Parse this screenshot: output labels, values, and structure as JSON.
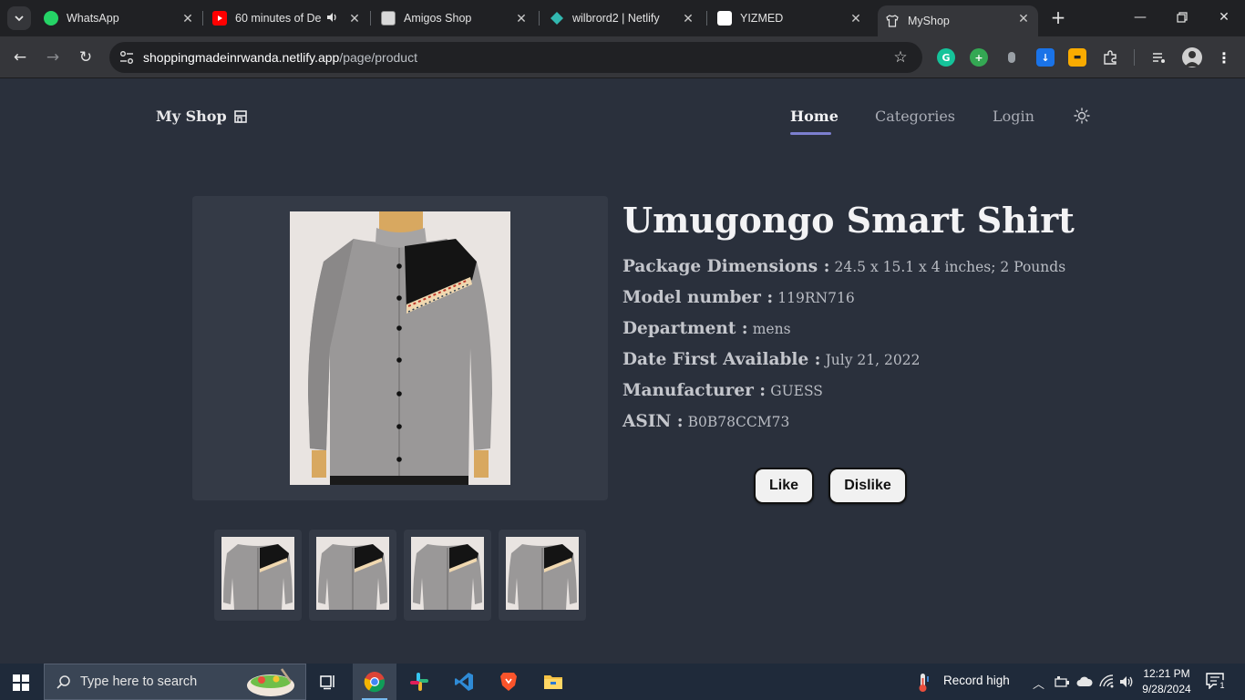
{
  "browser": {
    "tabs": [
      {
        "title": "WhatsApp"
      },
      {
        "title": "60 minutes of De"
      },
      {
        "title": "Amigos Shop"
      },
      {
        "title": "wilbrord2 | Netlify"
      },
      {
        "title": "YIZMED"
      },
      {
        "title": "MyShop"
      }
    ],
    "url_host": "shoppingmadeinrwanda.netlify.app",
    "url_path": "/page/product"
  },
  "site": {
    "brand": "My Shop",
    "nav": {
      "home": "Home",
      "categories": "Categories",
      "login": "Login"
    }
  },
  "product": {
    "title": "Umugongo Smart Shirt",
    "specs": [
      {
        "label": "Package Dimensions :",
        "value": "24.5 x 15.1 x 4 inches; 2 Pounds"
      },
      {
        "label": "Model number :",
        "value": "119RN716"
      },
      {
        "label": "Department :",
        "value": "mens"
      },
      {
        "label": "Date First Available :",
        "value": "July 21, 2022"
      },
      {
        "label": "Manufacturer :",
        "value": "GUESS"
      },
      {
        "label": "ASIN :",
        "value": "B0B78CCM73"
      }
    ],
    "like_label": "Like",
    "dislike_label": "Dislike"
  },
  "taskbar": {
    "search_placeholder": "Type here to search",
    "weather": "Record high",
    "time": "12:21 PM",
    "date": "9/28/2024",
    "notifications": "1"
  },
  "colors": {
    "page_bg": "#2a303c",
    "card_bg": "#343a46",
    "accent_underline": "#7c7fcf"
  }
}
